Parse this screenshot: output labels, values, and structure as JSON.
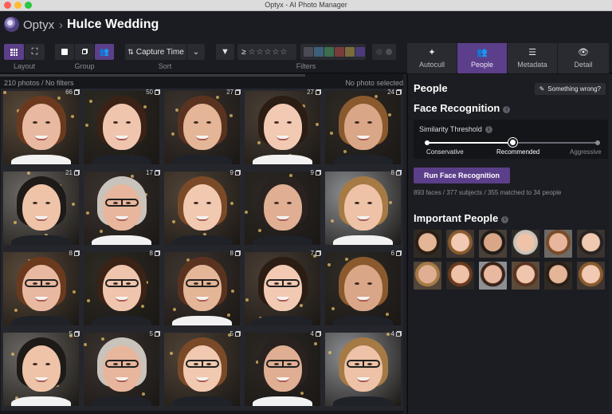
{
  "window": {
    "title": "Optyx - AI Photo Manager"
  },
  "header": {
    "brand": "Optyx",
    "separator": "›",
    "project": "Hulce Wedding"
  },
  "toolbar": {
    "groups": [
      {
        "label": "Layout"
      },
      {
        "label": "Group"
      },
      {
        "label": "Sort"
      },
      {
        "label": "Filters"
      }
    ],
    "sort_value": "Capture Time",
    "rating_prefix": "≥",
    "stars": "☆☆☆☆☆",
    "color_labels": [
      "#4a4b55",
      "#3d5f7a",
      "#3b6e4c",
      "#7a3b3b",
      "#7a6b3b",
      "#4b3b7a"
    ],
    "tabs": [
      {
        "label": "Autocull",
        "icon": "wand-icon"
      },
      {
        "label": "People",
        "icon": "people-icon"
      },
      {
        "label": "Metadata",
        "icon": "list-icon"
      },
      {
        "label": "Detail",
        "icon": "eye-icon"
      }
    ],
    "active_tab": "People"
  },
  "grid": {
    "photo_count": "210 photos / No filters",
    "selection": "No photo selected",
    "counts": [
      "66",
      "50",
      "27",
      "27",
      "24",
      "21",
      "17",
      "9",
      "9",
      "8",
      "8",
      "8",
      "8",
      "7",
      "6",
      "5",
      "5",
      "5",
      "4",
      "4"
    ]
  },
  "panel": {
    "title": "People",
    "report_button": "Something wrong?",
    "face_recognition": {
      "title": "Face Recognition",
      "threshold_label": "Similarity Threshold",
      "levels": [
        "Conservative",
        "Recommended",
        "Aggressive"
      ],
      "selected_level": "Recommended",
      "run_button": "Run Face Recognition",
      "stats": "893 faces / 377 subjects / 355 matched to 34 people"
    },
    "important_people": {
      "title": "Important People"
    }
  }
}
